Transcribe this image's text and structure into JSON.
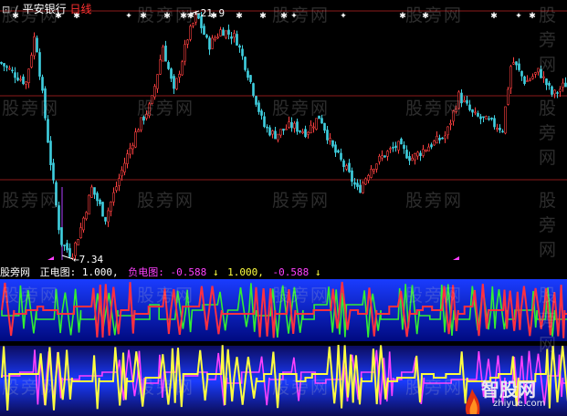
{
  "title": {
    "marker": "⊡",
    "prefix": "/",
    "stock_name": "平安银行",
    "period": "日线"
  },
  "annotations": {
    "high": "←21.9",
    "low": "←7.34"
  },
  "indicator": {
    "name": "股旁网",
    "pos_label": "正电图:",
    "pos_value": "1.000,",
    "neg_label": "负电图:",
    "neg_value": "-0.588",
    "arrow": "↓",
    "pos_value2": "1.000,",
    "neg_value2": "-0.588"
  },
  "watermark": "股旁网",
  "brand": {
    "name": "智股网",
    "url": "zhiyue.com"
  },
  "colors": {
    "up": "#ff4040",
    "down": "#40d0e0",
    "guide": "#8b1a1a",
    "pos_line": "#ff3040",
    "neg_line": "#33ee33",
    "yellow_line": "#ffff40",
    "magenta_line": "#ff40ff",
    "panel_top": "#1a3cff",
    "panel_bottom": "#000a80"
  },
  "price_series": {
    "start": 19.0,
    "high": 21.9,
    "low": 7.34,
    "anchors": [
      [
        0,
        19.0
      ],
      [
        18,
        18.2
      ],
      [
        28,
        17.8
      ],
      [
        38,
        20.8
      ],
      [
        45,
        17.5
      ],
      [
        56,
        12.5
      ],
      [
        66,
        8.2
      ],
      [
        78,
        7.34
      ],
      [
        88,
        9.0
      ],
      [
        100,
        11.4
      ],
      [
        115,
        9.6
      ],
      [
        135,
        12.8
      ],
      [
        150,
        15.0
      ],
      [
        165,
        16.5
      ],
      [
        178,
        20.0
      ],
      [
        190,
        17.2
      ],
      [
        205,
        20.5
      ],
      [
        215,
        21.9
      ],
      [
        228,
        20.0
      ],
      [
        242,
        21.0
      ],
      [
        258,
        20.5
      ],
      [
        272,
        18.2
      ],
      [
        288,
        15.2
      ],
      [
        300,
        14.6
      ],
      [
        318,
        15.2
      ],
      [
        335,
        14.8
      ],
      [
        350,
        15.8
      ],
      [
        362,
        14.0
      ],
      [
        378,
        12.6
      ],
      [
        392,
        11.2
      ],
      [
        405,
        12.6
      ],
      [
        420,
        13.4
      ],
      [
        435,
        14.0
      ],
      [
        450,
        13.2
      ],
      [
        470,
        14.0
      ],
      [
        488,
        14.6
      ],
      [
        502,
        17.0
      ],
      [
        518,
        15.8
      ],
      [
        535,
        15.4
      ],
      [
        550,
        15.0
      ],
      [
        560,
        19.2
      ],
      [
        575,
        17.8
      ],
      [
        590,
        18.5
      ],
      [
        605,
        17.0
      ],
      [
        621,
        17.8
      ]
    ]
  },
  "signal_markers": [
    "✱",
    "✱",
    "✱",
    "✦",
    "✱",
    "✱",
    "✱",
    "✱",
    "✱",
    "✱",
    "✱",
    "✱",
    "✦",
    "✦",
    "✱",
    "✱",
    "✱",
    "✦",
    "✱"
  ]
}
